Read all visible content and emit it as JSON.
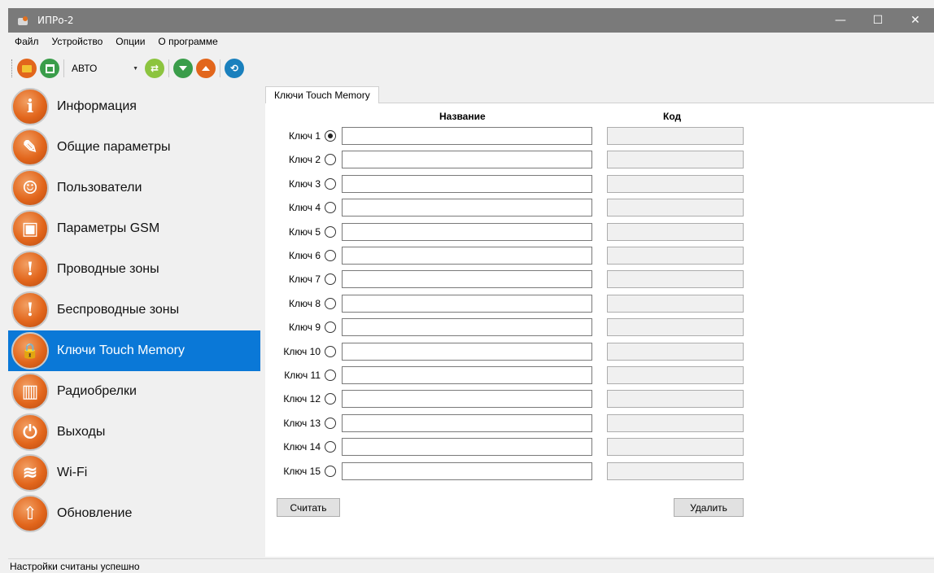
{
  "window": {
    "title": "ИПРо-2",
    "controls": {
      "minimize": "—",
      "maximize": "☐",
      "close": "✕"
    }
  },
  "menu": [
    "Файл",
    "Устройство",
    "Опции",
    "О программе"
  ],
  "toolbar": {
    "mode_value": "АВТО"
  },
  "sidebar": {
    "items": [
      {
        "label": "Информация",
        "icon": "info-icon",
        "glyph": "i"
      },
      {
        "label": "Общие параметры",
        "icon": "wrench-icon",
        "glyph": "✎"
      },
      {
        "label": "Пользователи",
        "icon": "users-icon",
        "glyph": "☺"
      },
      {
        "label": "Параметры GSM",
        "icon": "sim-card-icon",
        "glyph": "▣"
      },
      {
        "label": "Проводные зоны",
        "icon": "wired-zone-icon",
        "glyph": "!"
      },
      {
        "label": "Беспроводные зоны",
        "icon": "wireless-zone-icon",
        "glyph": "!"
      },
      {
        "label": "Ключи Touch Memory",
        "icon": "lock-icon",
        "glyph": "🔒"
      },
      {
        "label": "Радиобрелки",
        "icon": "keyfob-icon",
        "glyph": "▥"
      },
      {
        "label": "Выходы",
        "icon": "outputs-icon",
        "glyph": "⏻"
      },
      {
        "label": "Wi-Fi",
        "icon": "wifi-icon",
        "glyph": "≋"
      },
      {
        "label": "Обновление",
        "icon": "update-icon",
        "glyph": "⇧"
      }
    ],
    "active_index": 6
  },
  "tab": {
    "label": "Ключи Touch Memory"
  },
  "table": {
    "name_header": "Название",
    "code_header": "Код",
    "selected_index": 0,
    "rows": [
      {
        "label": "Ключ 1",
        "name": "",
        "code": ""
      },
      {
        "label": "Ключ 2",
        "name": "",
        "code": ""
      },
      {
        "label": "Ключ 3",
        "name": "",
        "code": ""
      },
      {
        "label": "Ключ 4",
        "name": "",
        "code": ""
      },
      {
        "label": "Ключ 5",
        "name": "",
        "code": ""
      },
      {
        "label": "Ключ 6",
        "name": "",
        "code": ""
      },
      {
        "label": "Ключ 7",
        "name": "",
        "code": ""
      },
      {
        "label": "Ключ 8",
        "name": "",
        "code": ""
      },
      {
        "label": "Ключ 9",
        "name": "",
        "code": ""
      },
      {
        "label": "Ключ 10",
        "name": "",
        "code": ""
      },
      {
        "label": "Ключ 11",
        "name": "",
        "code": ""
      },
      {
        "label": "Ключ 12",
        "name": "",
        "code": ""
      },
      {
        "label": "Ключ 13",
        "name": "",
        "code": ""
      },
      {
        "label": "Ключ 14",
        "name": "",
        "code": ""
      },
      {
        "label": "Ключ 15",
        "name": "",
        "code": ""
      }
    ]
  },
  "buttons": {
    "read": "Считать",
    "delete": "Удалить"
  },
  "status": {
    "text": "Настройки считаны успешно"
  },
  "colors": {
    "accent": "#0a78d7",
    "icon_orange": "#e2661c",
    "titlebar": "#7a7a7a"
  }
}
